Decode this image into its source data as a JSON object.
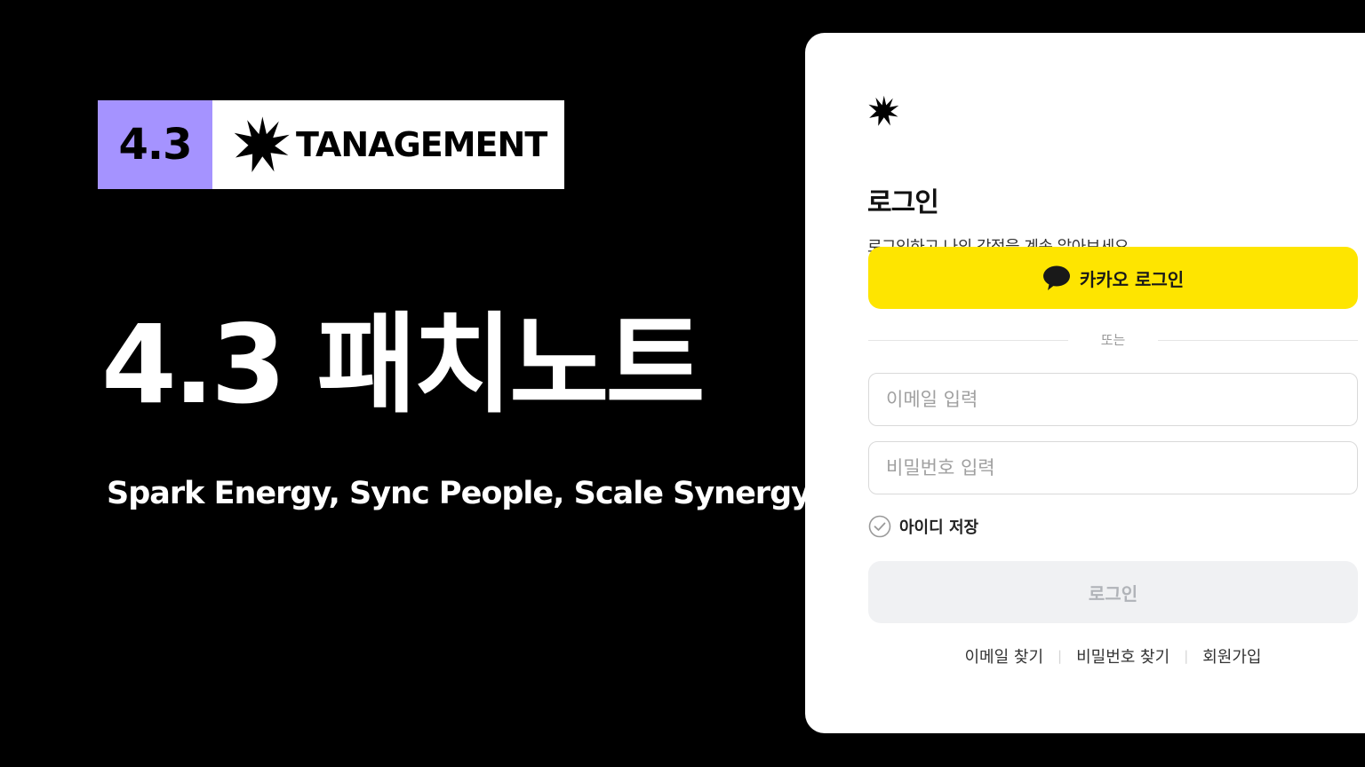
{
  "badge": {
    "version": "4.3",
    "brand_name": "TANAGEMENT",
    "version_bg": "#a593ff"
  },
  "hero": {
    "title": "4.3 패치노트",
    "subtitle": "Spark Energy, Sync People, Scale Synergy"
  },
  "login_panel": {
    "logo_icon": "spark-star-icon",
    "title": "로그인",
    "description": "로그인하고 나의 강점을 계속 알아보세요",
    "kakao_button": {
      "label": "카카오 로그인",
      "icon": "chat-bubble-icon",
      "color": "#fee500"
    },
    "divider_text": "또는",
    "email_input": {
      "placeholder": "이메일 입력",
      "value": ""
    },
    "password_input": {
      "placeholder": "비밀번호 입력",
      "value": ""
    },
    "remember_id": {
      "label": "아이디 저장",
      "icon": "check-circle-icon",
      "checked": false
    },
    "login_button": {
      "label": "로그인"
    },
    "footer_links": [
      "이메일 찾기",
      "비밀번호 찾기",
      "회원가입"
    ]
  }
}
